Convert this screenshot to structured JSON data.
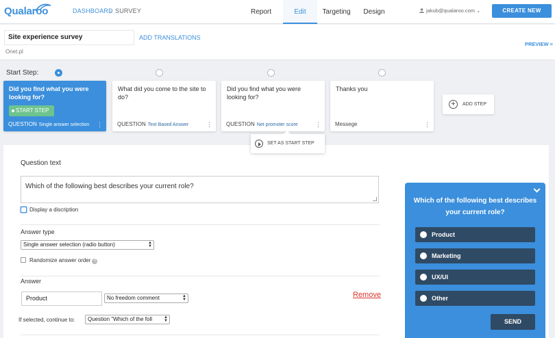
{
  "header": {
    "logo_text": "Qualaroo",
    "breadcrumb": {
      "dashboard": "DASHBOARD",
      "separator": "›",
      "current": "SURVEY"
    },
    "tabs": [
      {
        "label": "Report"
      },
      {
        "label": "Edit",
        "active": true
      },
      {
        "label": "Targeting"
      },
      {
        "label": "Design"
      }
    ],
    "user_email": "jakub@qualaroo.com",
    "user_chevron": "⌄",
    "create_button": "CREATE NEW"
  },
  "survey": {
    "title": "Site experience survey",
    "add_translations": "ADD TRANSLATIONS",
    "site": "Onet.pl",
    "preview_link": "PREVIEW ≡"
  },
  "steps": {
    "start_label": "Start Step:",
    "cards": [
      {
        "text": "Did you find what you were looking for?",
        "kind": "QUESTION",
        "type": "Single answer selection",
        "badge": "START STEP"
      },
      {
        "text": "What did you come to the site to do?",
        "kind": "QUESTION",
        "type": "Text Based Answer"
      },
      {
        "text": "Did you find what you were looking for?",
        "kind": "QUESTION",
        "type": "Net promoter score"
      },
      {
        "text": "Thanks you",
        "kind": "Messege",
        "type": ""
      }
    ],
    "add_step": "ADD STEP",
    "set_as_start": "SET AS START STEP"
  },
  "editor": {
    "question_text_label": "Question text",
    "question_text_value": "Which of the following best describes your current role?",
    "display_description": "Display a discription",
    "answer_type_label": "Answer type",
    "answer_type_value": "Single answer selection (radio button)",
    "randomize_label": "Randomize answer order",
    "answer_label": "Answer",
    "answer_value": "Product",
    "freedom_value": "No freedom comment",
    "remove": "Remove",
    "continue_label": "If selected, continue to:",
    "continue_value": "Question \"Which of the foll"
  },
  "preview": {
    "question": "Which of the following best describes your current role?",
    "options": [
      "Product",
      "Marketing",
      "UX/UI",
      "Other"
    ],
    "send": "SEND"
  },
  "colors": {
    "accent": "#3b8fdc",
    "start_badge": "#6ec48e",
    "preview_option": "#2f4a65",
    "remove": "#d9342b"
  }
}
